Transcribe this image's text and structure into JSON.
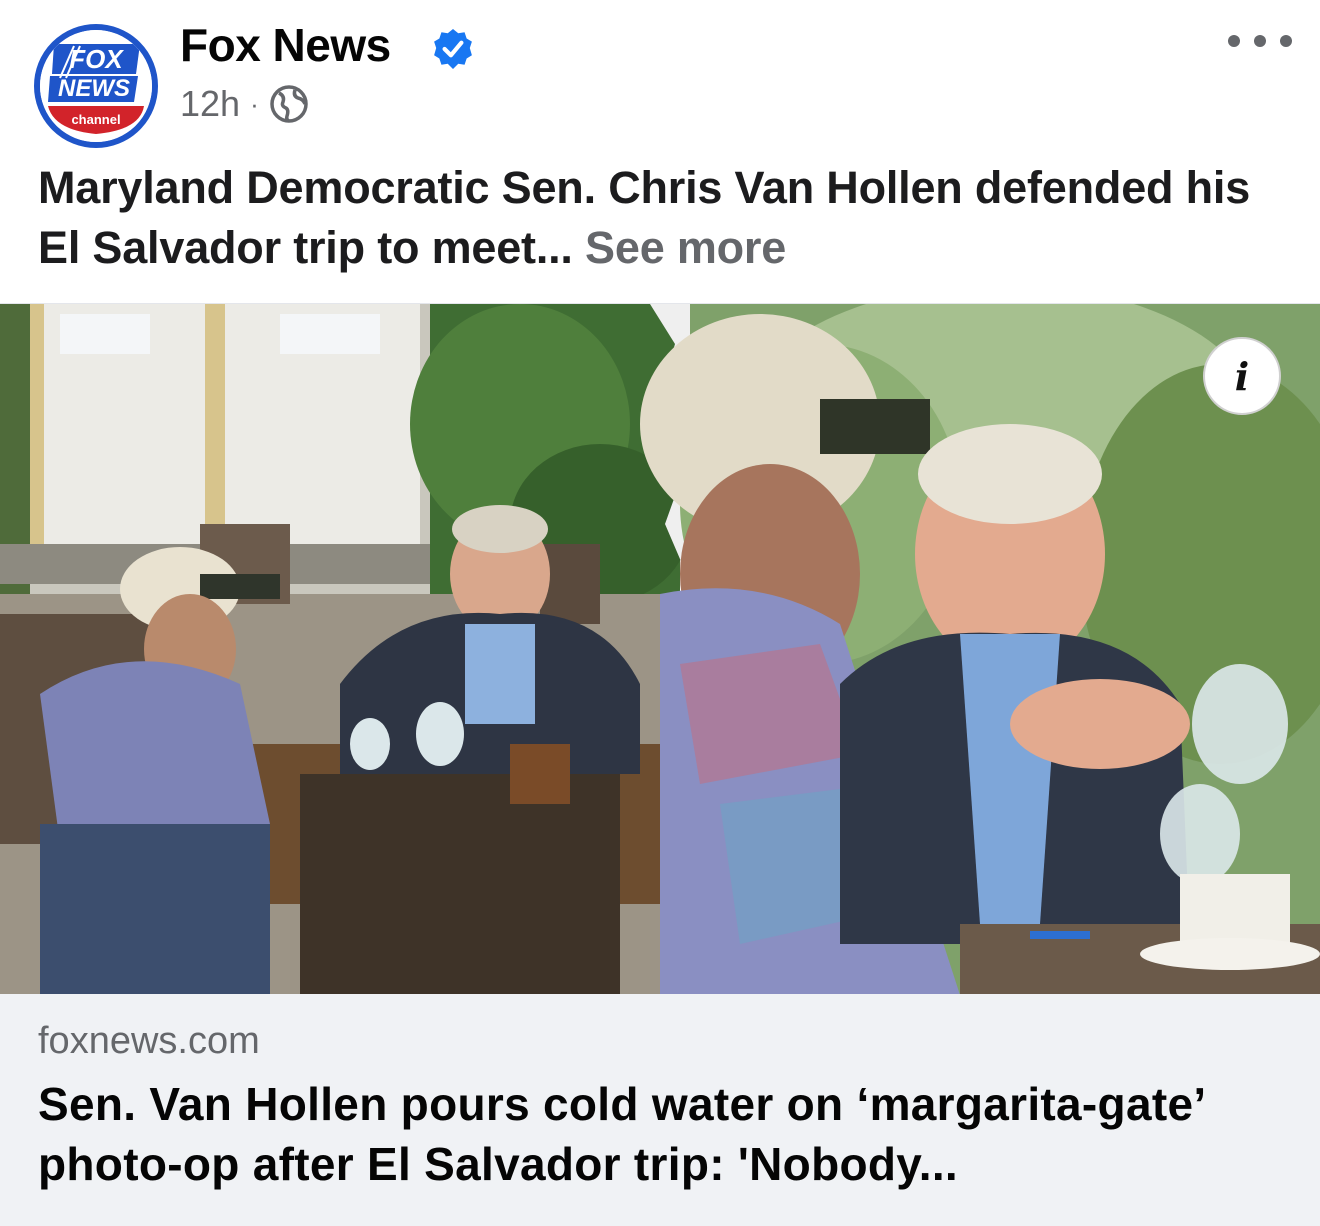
{
  "post": {
    "page_name": "Fox News",
    "time": "12h",
    "separator": "·",
    "caption_text": "Maryland Democratic Sen. Chris Van Hollen defended his El Salvador trip to meet...",
    "see_more": "See more",
    "info_label": "i"
  },
  "avatar": {
    "line1": "FOX",
    "line2": "NEWS",
    "line3": "channel"
  },
  "link_preview": {
    "domain": "foxnews.com",
    "title": "Sen. Van Hollen pours cold water on ‘margarita-gate’ photo-op after El Salvador trip: 'Nobody..."
  },
  "colors": {
    "verified": "#1877f2",
    "secondary_text": "#65676b",
    "link_bg": "#f0f2f5",
    "fox_blue": "#1f55c9",
    "fox_red": "#d2232a"
  },
  "icons": [
    "verified-badge-icon",
    "globe-icon",
    "more-options-icon",
    "info-icon"
  ]
}
